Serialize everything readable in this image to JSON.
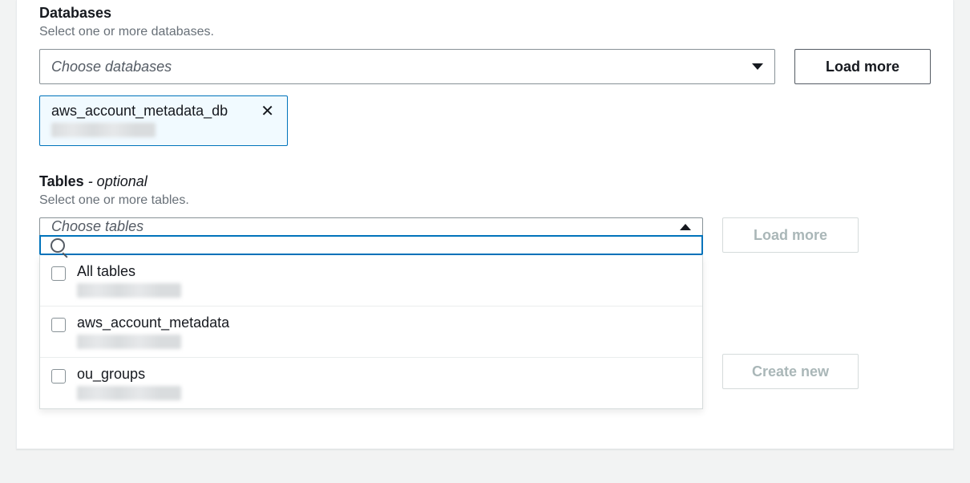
{
  "databases": {
    "label": "Databases",
    "hint": "Select one or more databases.",
    "placeholder": "Choose databases",
    "load_more": "Load more",
    "selected_token": {
      "name": "aws_account_metadata_db"
    }
  },
  "tables": {
    "label": "Tables",
    "optional_suffix": " - optional",
    "hint": "Select one or more tables.",
    "placeholder": "Choose tables",
    "load_more": "Load more",
    "search_value": "",
    "options": [
      {
        "label": "All tables"
      },
      {
        "label": "aws_account_metadata"
      },
      {
        "label": "ou_groups"
      }
    ]
  },
  "filters": {
    "create_new": "Create new"
  }
}
